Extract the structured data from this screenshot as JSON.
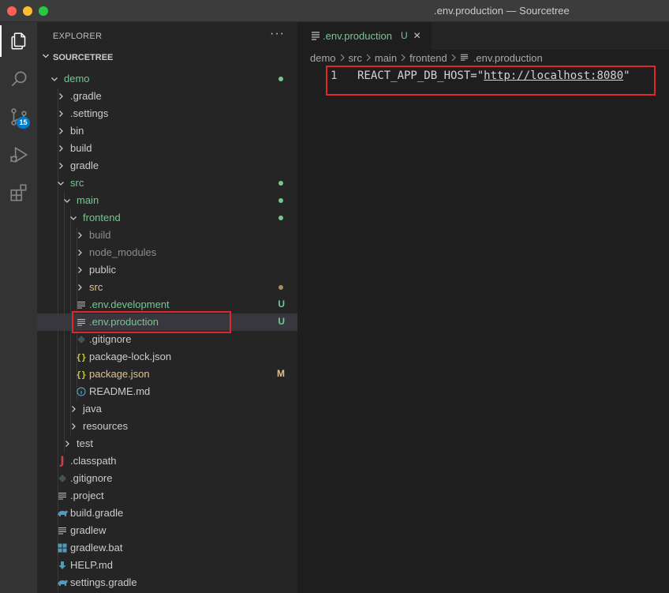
{
  "window": {
    "title": ".env.production — Sourcetree"
  },
  "activity_bar": {
    "items": [
      {
        "name": "explorer-icon"
      },
      {
        "name": "search-icon"
      },
      {
        "name": "source-control-icon",
        "badge": "15"
      },
      {
        "name": "run-debug-icon"
      },
      {
        "name": "extensions-icon"
      }
    ]
  },
  "sidebar": {
    "header": "EXPLORER",
    "more": "···",
    "root": "SOURCETREE",
    "tree": [
      {
        "label": "demo",
        "depth": 0,
        "type": "folder-open",
        "color": "green",
        "dot": "green"
      },
      {
        "label": ".gradle",
        "depth": 1,
        "type": "folder",
        "color": "normal"
      },
      {
        "label": ".settings",
        "depth": 1,
        "type": "folder",
        "color": "normal"
      },
      {
        "label": "bin",
        "depth": 1,
        "type": "folder",
        "color": "normal"
      },
      {
        "label": "build",
        "depth": 1,
        "type": "folder",
        "color": "normal"
      },
      {
        "label": "gradle",
        "depth": 1,
        "type": "folder",
        "color": "normal"
      },
      {
        "label": "src",
        "depth": 1,
        "type": "folder-open",
        "color": "green",
        "dot": "green"
      },
      {
        "label": "main",
        "depth": 2,
        "type": "folder-open",
        "color": "green",
        "dot": "green"
      },
      {
        "label": "frontend",
        "depth": 3,
        "type": "folder-open",
        "color": "green",
        "dot": "green"
      },
      {
        "label": "build",
        "depth": 4,
        "type": "folder",
        "color": "dim"
      },
      {
        "label": "node_modules",
        "depth": 4,
        "type": "folder",
        "color": "dim"
      },
      {
        "label": "public",
        "depth": 4,
        "type": "folder",
        "color": "normal"
      },
      {
        "label": "src",
        "depth": 4,
        "type": "folder",
        "color": "yellow",
        "dot": "yellow"
      },
      {
        "label": ".env.development",
        "depth": 4,
        "type": "file-lines",
        "color": "green",
        "deco": "U"
      },
      {
        "label": ".env.production",
        "depth": 4,
        "type": "file-lines",
        "color": "green",
        "deco": "U",
        "selected": true
      },
      {
        "label": ".gitignore",
        "depth": 4,
        "type": "file-git",
        "color": "normal"
      },
      {
        "label": "package-lock.json",
        "depth": 4,
        "type": "file-json",
        "color": "normal"
      },
      {
        "label": "package.json",
        "depth": 4,
        "type": "file-json",
        "color": "yellow",
        "deco": "M"
      },
      {
        "label": "README.md",
        "depth": 4,
        "type": "file-info",
        "color": "normal"
      },
      {
        "label": "java",
        "depth": 3,
        "type": "folder",
        "color": "normal"
      },
      {
        "label": "resources",
        "depth": 3,
        "type": "folder",
        "color": "normal"
      },
      {
        "label": "test",
        "depth": 2,
        "type": "folder",
        "color": "normal"
      },
      {
        "label": ".classpath",
        "depth": 1,
        "type": "file-java",
        "color": "normal"
      },
      {
        "label": ".gitignore",
        "depth": 1,
        "type": "file-git",
        "color": "normal"
      },
      {
        "label": ".project",
        "depth": 1,
        "type": "file-lines",
        "color": "normal"
      },
      {
        "label": "build.gradle",
        "depth": 1,
        "type": "file-gradle",
        "color": "normal"
      },
      {
        "label": "gradlew",
        "depth": 1,
        "type": "file-lines",
        "color": "normal"
      },
      {
        "label": "gradlew.bat",
        "depth": 1,
        "type": "file-windows",
        "color": "normal"
      },
      {
        "label": "HELP.md",
        "depth": 1,
        "type": "file-md",
        "color": "normal"
      },
      {
        "label": "settings.gradle",
        "depth": 1,
        "type": "file-gradle",
        "color": "normal"
      }
    ]
  },
  "editor": {
    "tab": {
      "label": ".env.production",
      "status": "U",
      "close": "×"
    },
    "breadcrumb": [
      "demo",
      "src",
      "main",
      "frontend",
      ".env.production"
    ],
    "lines": [
      {
        "number": "1",
        "key": "REACT_APP_DB_HOST=\"",
        "url": "http://localhost:8080",
        "end": "\""
      }
    ]
  },
  "colors": {
    "green": "#73c991",
    "yellow": "#e2c08d",
    "dim": "#8c8c8c",
    "normal": "#cccccc",
    "highlight": "#e3262b",
    "badge": "#007acc"
  }
}
